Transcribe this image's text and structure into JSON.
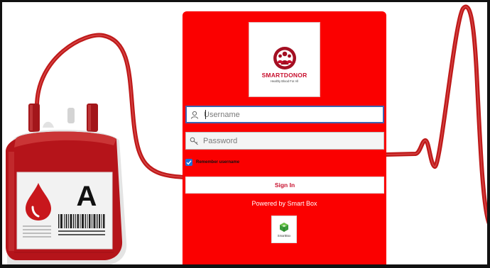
{
  "colors": {
    "panel": "#fb0000",
    "brand_red": "#c8102e",
    "tube": "#bf1a1a",
    "checkbox": "#1e6fd9"
  },
  "blood_bag": {
    "blood_type": "A",
    "icon": "blood-drop-icon"
  },
  "logo": {
    "title": "SMARTDONOR",
    "tagline": "Healthy Blood For All",
    "icon": "donor-family-icon"
  },
  "login": {
    "username_placeholder": "Username",
    "username_icon": "user-icon",
    "password_placeholder": "Password",
    "password_icon": "key-icon",
    "remember_label": "Remember username",
    "remember_checked": true,
    "signin_label": "Sign In"
  },
  "footer": {
    "powered_by": "Powered by Smart Box",
    "smartbox_label": "SmartBox",
    "smartbox_icon": "smartbox-cube-icon"
  }
}
